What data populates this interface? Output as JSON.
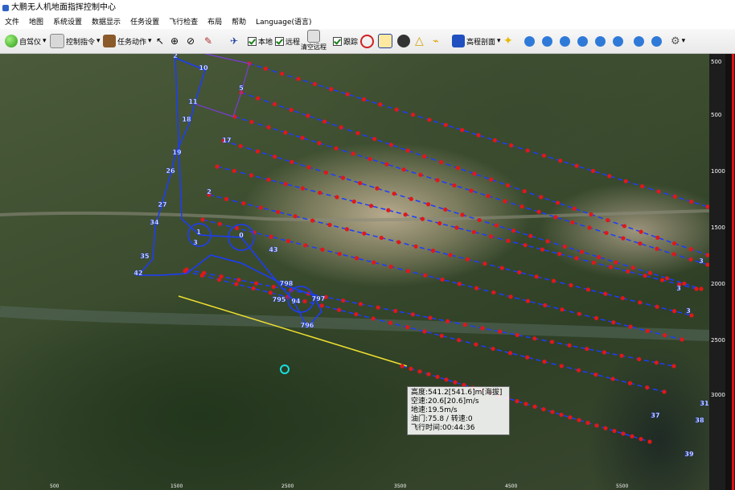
{
  "window": {
    "title": "大鹏无人机地面指挥控制中心"
  },
  "menu": [
    "文件",
    "地图",
    "系统设置",
    "数据显示",
    "任务设置",
    "飞行检查",
    "布局",
    "帮助",
    "Language(语言)"
  ],
  "toolbar": {
    "autopilot_label": "自驾仪",
    "control_cmd_label": "控制指令",
    "task_action_label": "任务动作",
    "local_label": "本地",
    "remote_label": "远程",
    "clear_remote_label": "清空远程",
    "track_label": "跟踪",
    "profile_label": "高程剖面",
    "local_checked": true,
    "remote_checked": true,
    "track_checked": true
  },
  "telemetry": {
    "altitude": "高度:541.2[541.6]m[海拔]",
    "airspeed": "空速:20.6[20.6]m/s",
    "groundspeed": "地速:19.5m/s",
    "throttle": "油门:75.8 / 转速:0",
    "flight_time": "飞行时间:00:44:36"
  },
  "waypoints": {
    "labels": [
      "2",
      "10",
      "5",
      "11",
      "18",
      "17",
      "19",
      "26",
      "2",
      "27",
      "34",
      "1",
      "0",
      "3",
      "35",
      "42",
      "43",
      "798",
      "795",
      "94",
      "797",
      "796",
      "31",
      "30",
      "37",
      "38",
      "39",
      "23",
      "3",
      "3",
      "3"
    ]
  },
  "scale_right": [
    "500",
    "500",
    "1000",
    "1500",
    "2000",
    "2500",
    "3000"
  ],
  "scale_bottom": [
    "500",
    "1500",
    "2500",
    "3500",
    "4500",
    "5500"
  ],
  "colors": {
    "route_red": "#e01818",
    "route_blue": "#1c3cff",
    "link_yellow": "#f0e030",
    "waypoint": "#ffffff"
  }
}
